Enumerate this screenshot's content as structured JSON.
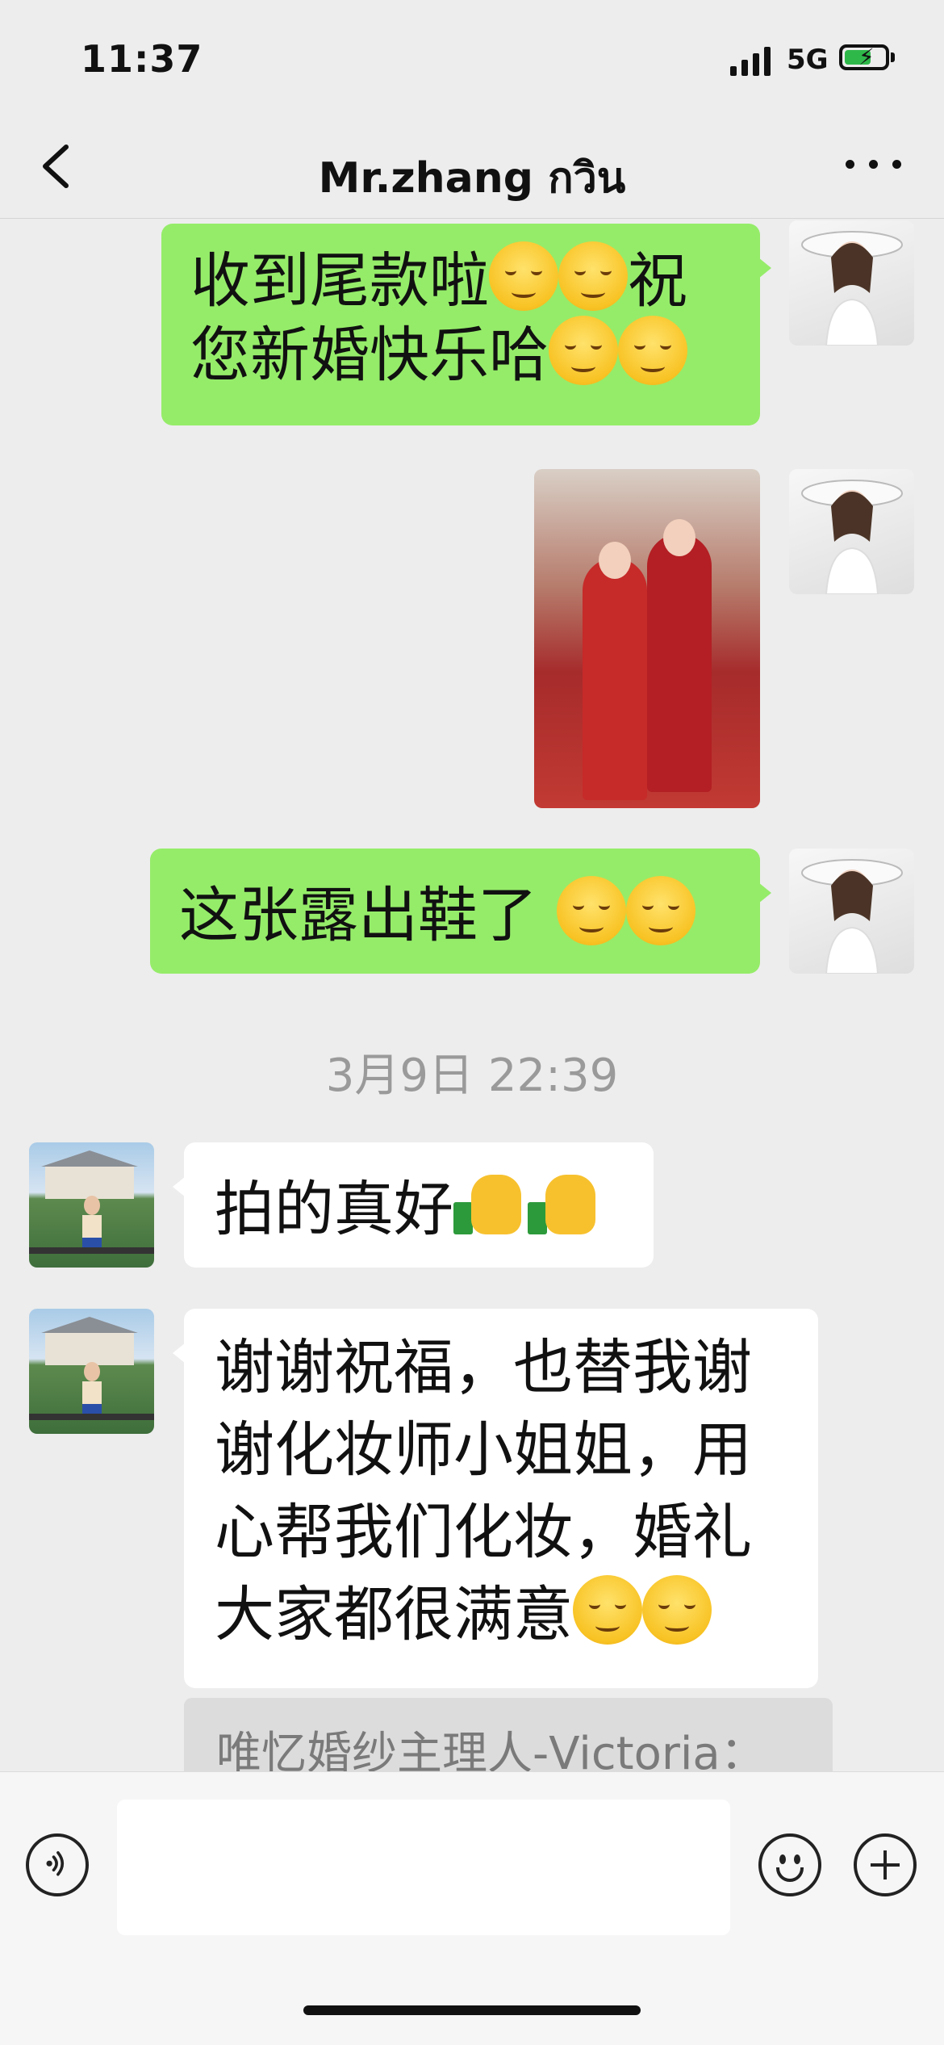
{
  "status_bar": {
    "time": "11:37",
    "network": "5G"
  },
  "header": {
    "title": "Mr.zhang กวิน"
  },
  "messages": [
    {
      "from": "me",
      "type": "text",
      "lines": [
        "收到尾款啦",
        "祝",
        "您新婚快乐哈"
      ]
    },
    {
      "from": "me",
      "type": "image",
      "description": "wedding photo"
    },
    {
      "from": "me",
      "type": "text",
      "lines": [
        "这张露出鞋了 "
      ]
    },
    {
      "type": "timestamp",
      "text": "3月9日 22:39"
    },
    {
      "from": "contact",
      "type": "text",
      "lines": [
        "拍的真好"
      ]
    },
    {
      "from": "contact",
      "type": "text",
      "lines": [
        "谢谢祝福，也替我谢",
        "谢化妆师小姐姐，用",
        "心帮我们化妆，婚礼",
        "大家都很满意"
      ],
      "quote": "唯忆婚纱主理人-Victoria："
    }
  ],
  "emoji_names": [
    "smirk-emoji",
    "blush-emoji",
    "relieved-emoji",
    "thumbs-up-emoji",
    "grin-emoji",
    "wink-tongue-emoji"
  ]
}
